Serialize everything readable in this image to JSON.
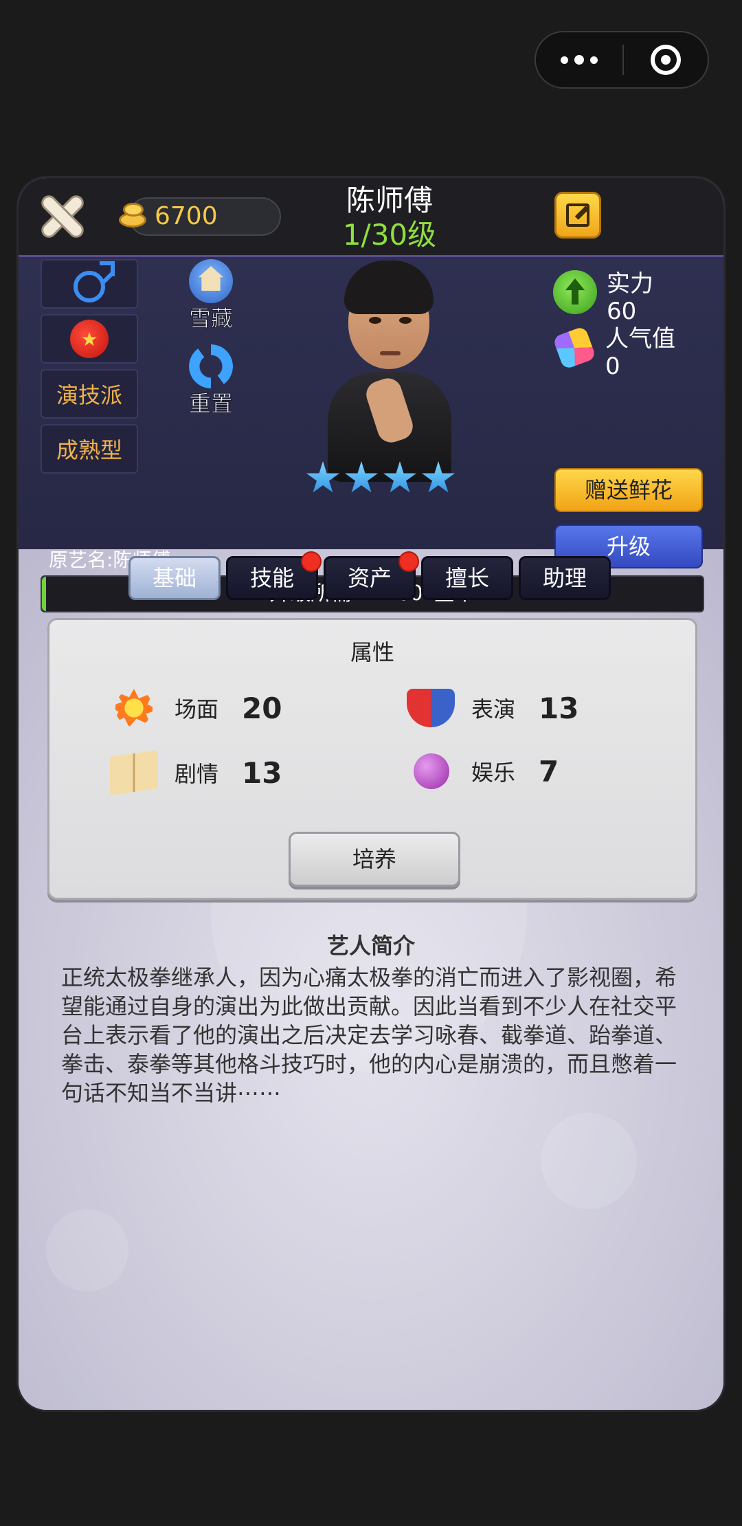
{
  "capsule": {
    "more_icon": "more-dots-icon",
    "close_icon": "target-close-icon"
  },
  "header": {
    "coins": "6700",
    "name": "陈师傅",
    "level": "1/30级",
    "colors": {
      "coin": "#f7c948",
      "level": "#8fe03c"
    }
  },
  "profile": {
    "tags": [
      "演技派",
      "成熟型"
    ],
    "actions": [
      {
        "label": "雪藏",
        "icon": "house-icon"
      },
      {
        "label": "重置",
        "icon": "reset-icon"
      }
    ],
    "original_name": "原艺名:陈师傅",
    "stars": 4,
    "strength_label": "实力",
    "strength_value": "60",
    "popularity_label": "人气值",
    "popularity_value": "0",
    "gift_button": "赠送鲜花",
    "upgrade_button": "升级"
  },
  "upgrade": {
    "label": "升级所需：",
    "amount": "260",
    "unit": "金币",
    "progress": 0.004
  },
  "tabs": [
    {
      "label": "基础",
      "active": true,
      "badge": false
    },
    {
      "label": "技能",
      "active": false,
      "badge": true
    },
    {
      "label": "资产",
      "active": false,
      "badge": true
    },
    {
      "label": "擅长",
      "active": false,
      "badge": false
    },
    {
      "label": "助理",
      "active": false,
      "badge": false
    }
  ],
  "attributes": {
    "title": "属性",
    "items": [
      {
        "label": "场面",
        "value": "20",
        "icon": "explosion-icon"
      },
      {
        "label": "表演",
        "value": "13",
        "icon": "drama-mask-icon"
      },
      {
        "label": "剧情",
        "value": "13",
        "icon": "book-icon"
      },
      {
        "label": "娱乐",
        "value": "7",
        "icon": "disco-ball-icon"
      }
    ],
    "train_button": "培养"
  },
  "intro": {
    "title": "艺人简介",
    "text": "正统太极拳继承人，因为心痛太极拳的消亡而进入了影视圈，希望能通过自身的演出为此做出贡献。因此当看到不少人在社交平台上表示看了他的演出之后决定去学习咏春、截拳道、跆拳道、拳击、泰拳等其他格斗技巧时，他的内心是崩溃的，而且憋着一句话不知当不当讲⋯⋯"
  }
}
